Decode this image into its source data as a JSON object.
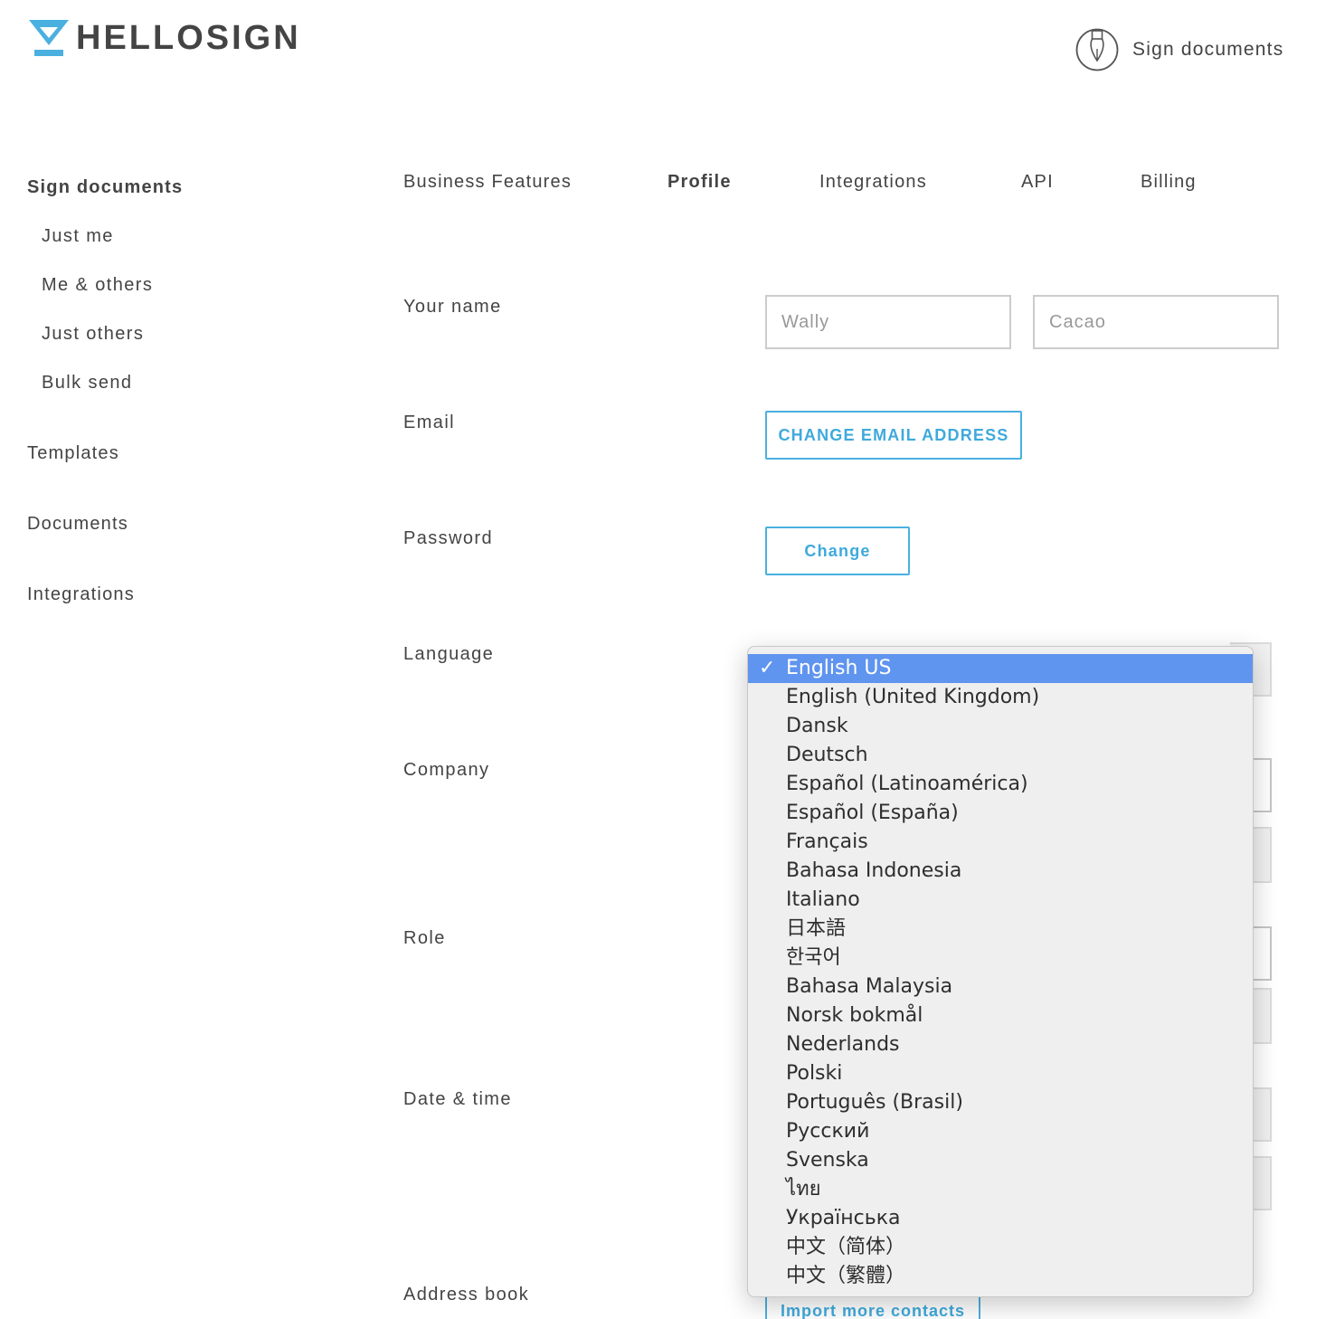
{
  "header": {
    "brand": "HELLOSIGN",
    "brand_color": "#4ab0e0",
    "sign_documents_label": "Sign documents",
    "sign_documents_icon": "pen-nib-icon"
  },
  "sidebar": {
    "section_title": "Sign documents",
    "sub_items": [
      {
        "label": "Just me"
      },
      {
        "label": "Me & others"
      },
      {
        "label": "Just others"
      },
      {
        "label": "Bulk send"
      }
    ],
    "main_items": [
      {
        "label": "Templates"
      },
      {
        "label": "Documents"
      },
      {
        "label": "Integrations"
      }
    ]
  },
  "tabs": [
    {
      "label": "Business Features",
      "active": false
    },
    {
      "label": "Profile",
      "active": true
    },
    {
      "label": "Integrations",
      "active": false
    },
    {
      "label": "API",
      "active": false
    },
    {
      "label": "Billing",
      "active": false
    }
  ],
  "form": {
    "your_name_label": "Your name",
    "first_name_value": "Wally",
    "last_name_value": "Cacao",
    "email_label": "Email",
    "change_email_button": "CHANGE EMAIL ADDRESS",
    "password_label": "Password",
    "change_password_button": "Change",
    "language_label": "Language",
    "company_label": "Company",
    "role_label": "Role",
    "date_time_label": "Date & time",
    "address_book_label": "Address book",
    "import_contacts_button": "Import more contacts"
  },
  "language_dropdown": {
    "selected": "English US",
    "selected_color": "#5f94ef",
    "check_glyph": "✓",
    "options": [
      "English US",
      "English (United Kingdom)",
      "Dansk",
      "Deutsch",
      "Español (Latinoamérica)",
      "Español (España)",
      "Français",
      "Bahasa Indonesia",
      "Italiano",
      "日本語",
      "한국어",
      "Bahasa Malaysia",
      "Norsk bokmål",
      "Nederlands",
      "Polski",
      "Português (Brasil)",
      "Русский",
      "Svenska",
      "ไทย",
      "Українська",
      "中文（简体）",
      "中文（繁體）"
    ]
  }
}
